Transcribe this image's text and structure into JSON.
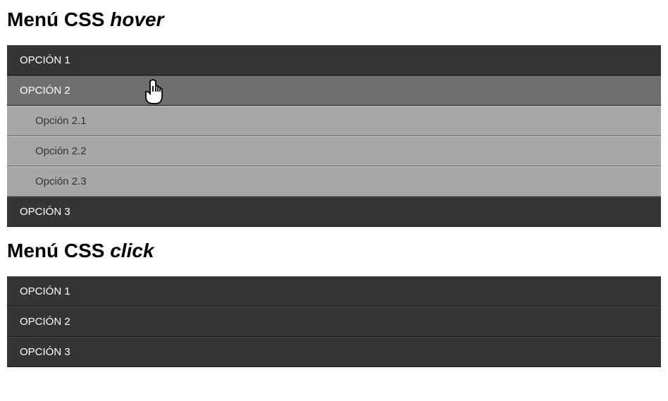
{
  "heading_hover": {
    "prefix": "Menú CSS ",
    "italic": "hover"
  },
  "heading_click": {
    "prefix": "Menú CSS ",
    "italic": "click"
  },
  "menu_hover": {
    "items": [
      {
        "label": "OPCIÓN 1",
        "hovered": false,
        "sub": []
      },
      {
        "label": "OPCIÓN 2",
        "hovered": true,
        "sub": [
          {
            "label": "Opción 2.1"
          },
          {
            "label": "Opción 2.2"
          },
          {
            "label": "Opción 2.3"
          }
        ]
      },
      {
        "label": "OPCIÓN 3",
        "hovered": false,
        "sub": []
      }
    ]
  },
  "menu_click": {
    "items": [
      {
        "label": "OPCIÓN 1"
      },
      {
        "label": "OPCIÓN 2"
      },
      {
        "label": "OPCIÓN 3"
      }
    ]
  }
}
